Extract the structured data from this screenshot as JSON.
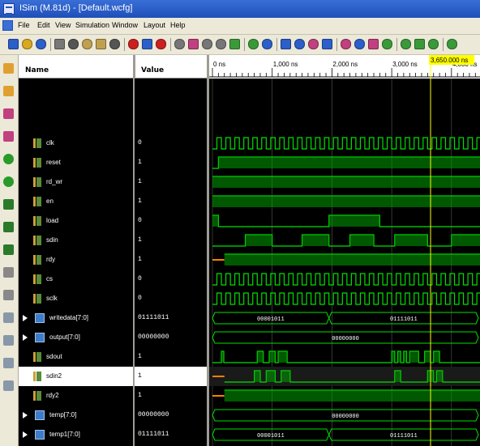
{
  "window": {
    "title": "ISim (M.81d) - [Default.wcfg]"
  },
  "menu": [
    "File",
    "Edit",
    "View",
    "Simulation",
    "Window",
    "Layout",
    "Help"
  ],
  "columns": {
    "name": "Name",
    "value": "Value"
  },
  "cursor": {
    "label": "3,650.000 ns",
    "time_ns": 3650
  },
  "time_axis": {
    "labels": [
      "0 ns",
      "1,000 ns",
      "2,000 ns",
      "3,000 ns",
      "4,000 ns"
    ],
    "ticks_ns": [
      0,
      1000,
      2000,
      3000,
      4000
    ],
    "range_ns": [
      0,
      4450
    ]
  },
  "signals": [
    {
      "name": "clk",
      "value": "0",
      "kind": "bit",
      "wave": "clock",
      "period": 150
    },
    {
      "name": "reset",
      "value": "1",
      "kind": "bit",
      "wave": "edges",
      "init": 0,
      "edges": [
        100
      ]
    },
    {
      "name": "rd_wr",
      "value": "1",
      "kind": "bit",
      "wave": "edges",
      "init": 1,
      "edges": []
    },
    {
      "name": "en",
      "value": "1",
      "kind": "bit",
      "wave": "edges",
      "init": 1,
      "edges": []
    },
    {
      "name": "load",
      "value": "0",
      "kind": "bit",
      "wave": "edges",
      "init": 1,
      "edges": [
        100,
        1950,
        2800
      ]
    },
    {
      "name": "sdin",
      "value": "1",
      "kind": "bit",
      "wave": "edges",
      "init": 0,
      "edges": [
        550,
        1000,
        1500,
        1950,
        2300,
        2700,
        3050,
        3600,
        4000
      ]
    },
    {
      "name": "rdy",
      "value": "1",
      "kind": "bit",
      "wave": "edges",
      "init": 0,
      "undef_until": 200,
      "edges": [
        200
      ]
    },
    {
      "name": "cs",
      "value": "0",
      "kind": "bit",
      "wave": "clock",
      "period": 150
    },
    {
      "name": "sclk",
      "value": "0",
      "kind": "bit",
      "wave": "clock",
      "period": 150
    },
    {
      "name": "writedata[7:0]",
      "value": "01111011",
      "kind": "bus",
      "bus_values": [
        {
          "from": 0,
          "to": 1950,
          "label": "00001011"
        },
        {
          "from": 1950,
          "to": 4450,
          "label": "01111011"
        }
      ]
    },
    {
      "name": "output[7:0]",
      "value": "00000000",
      "kind": "bus",
      "bus_values": [
        {
          "from": 0,
          "to": 4450,
          "label": "00000000"
        }
      ]
    },
    {
      "name": "sdout",
      "value": "1",
      "kind": "bit",
      "wave": "edges",
      "init": 0,
      "edges": [
        150,
        190,
        750,
        850,
        950,
        1050,
        1100,
        1250,
        3000,
        3050,
        3100,
        3150,
        3200,
        3250,
        3300,
        3450,
        3550,
        3650,
        3700,
        3800
      ]
    },
    {
      "name": "sdin2",
      "value": "1",
      "kind": "bit",
      "wave": "edges",
      "init": 0,
      "undef_until": 200,
      "edges": [
        700,
        800,
        900,
        1050,
        1150,
        1300,
        3050,
        3150,
        3600,
        3700,
        3750,
        3850
      ],
      "selected": true
    },
    {
      "name": "rdy2",
      "value": "1",
      "kind": "bit",
      "wave": "edges",
      "init": 0,
      "undef_until": 200,
      "edges": [
        200
      ]
    },
    {
      "name": "temp[7:0]",
      "value": "00000000",
      "kind": "bus",
      "bus_values": [
        {
          "from": 0,
          "to": 4450,
          "label": "00000000"
        }
      ]
    },
    {
      "name": "temp1[7:0]",
      "value": "01111011",
      "kind": "bus",
      "bus_values": [
        {
          "from": 0,
          "to": 1950,
          "label": "00001011"
        },
        {
          "from": 1950,
          "to": 4450,
          "label": "01111011"
        }
      ]
    }
  ],
  "colors": {
    "wave": "#00e000",
    "bus_fill": "#00a000",
    "cursor": "#ffff00",
    "undefined": "#ff8000",
    "grid": "#5a5a5a"
  },
  "toolbar_icons": [
    "new-icon",
    "open-icon",
    "save-icon",
    "print-icon",
    "cut-icon",
    "copy-icon",
    "paste-icon",
    "delete-icon",
    "stop-icon",
    "undo-icon",
    "redo-icon",
    "find-icon",
    "find-next-icon",
    "info-icon",
    "zoom-icon",
    "restart-icon",
    "run-icon",
    "run-all-icon",
    "step-icon",
    "break-icon",
    "marker-icon",
    "help-icon",
    "zoom-in-icon",
    "zoom-out-icon",
    "zoom-fit-icon",
    "zoom-full-icon",
    "cursor-icon",
    "prev-marker-icon",
    "next-marker-icon",
    "swap-icon"
  ]
}
